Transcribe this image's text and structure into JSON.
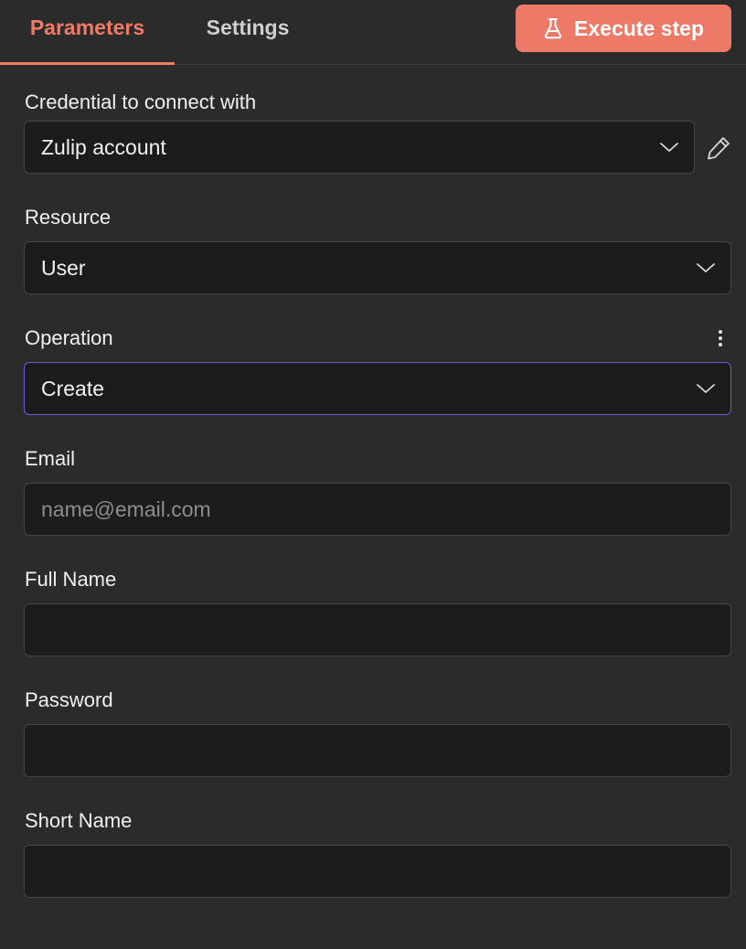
{
  "tabs": {
    "parameters": "Parameters",
    "settings": "Settings"
  },
  "execute_button": {
    "label": "Execute step",
    "icon": "flask-icon",
    "color": "#ec7a66"
  },
  "accent_color": "#ef7b67",
  "focus_color": "#6b5bd6",
  "fields": {
    "credential": {
      "label": "Credential to connect with",
      "value": "Zulip account"
    },
    "resource": {
      "label": "Resource",
      "value": "User"
    },
    "operation": {
      "label": "Operation",
      "value": "Create"
    },
    "email": {
      "label": "Email",
      "value": "",
      "placeholder": "name@email.com"
    },
    "full_name": {
      "label": "Full Name",
      "value": "",
      "placeholder": ""
    },
    "password": {
      "label": "Password",
      "value": "",
      "placeholder": ""
    },
    "short_name": {
      "label": "Short Name",
      "value": "",
      "placeholder": ""
    }
  }
}
